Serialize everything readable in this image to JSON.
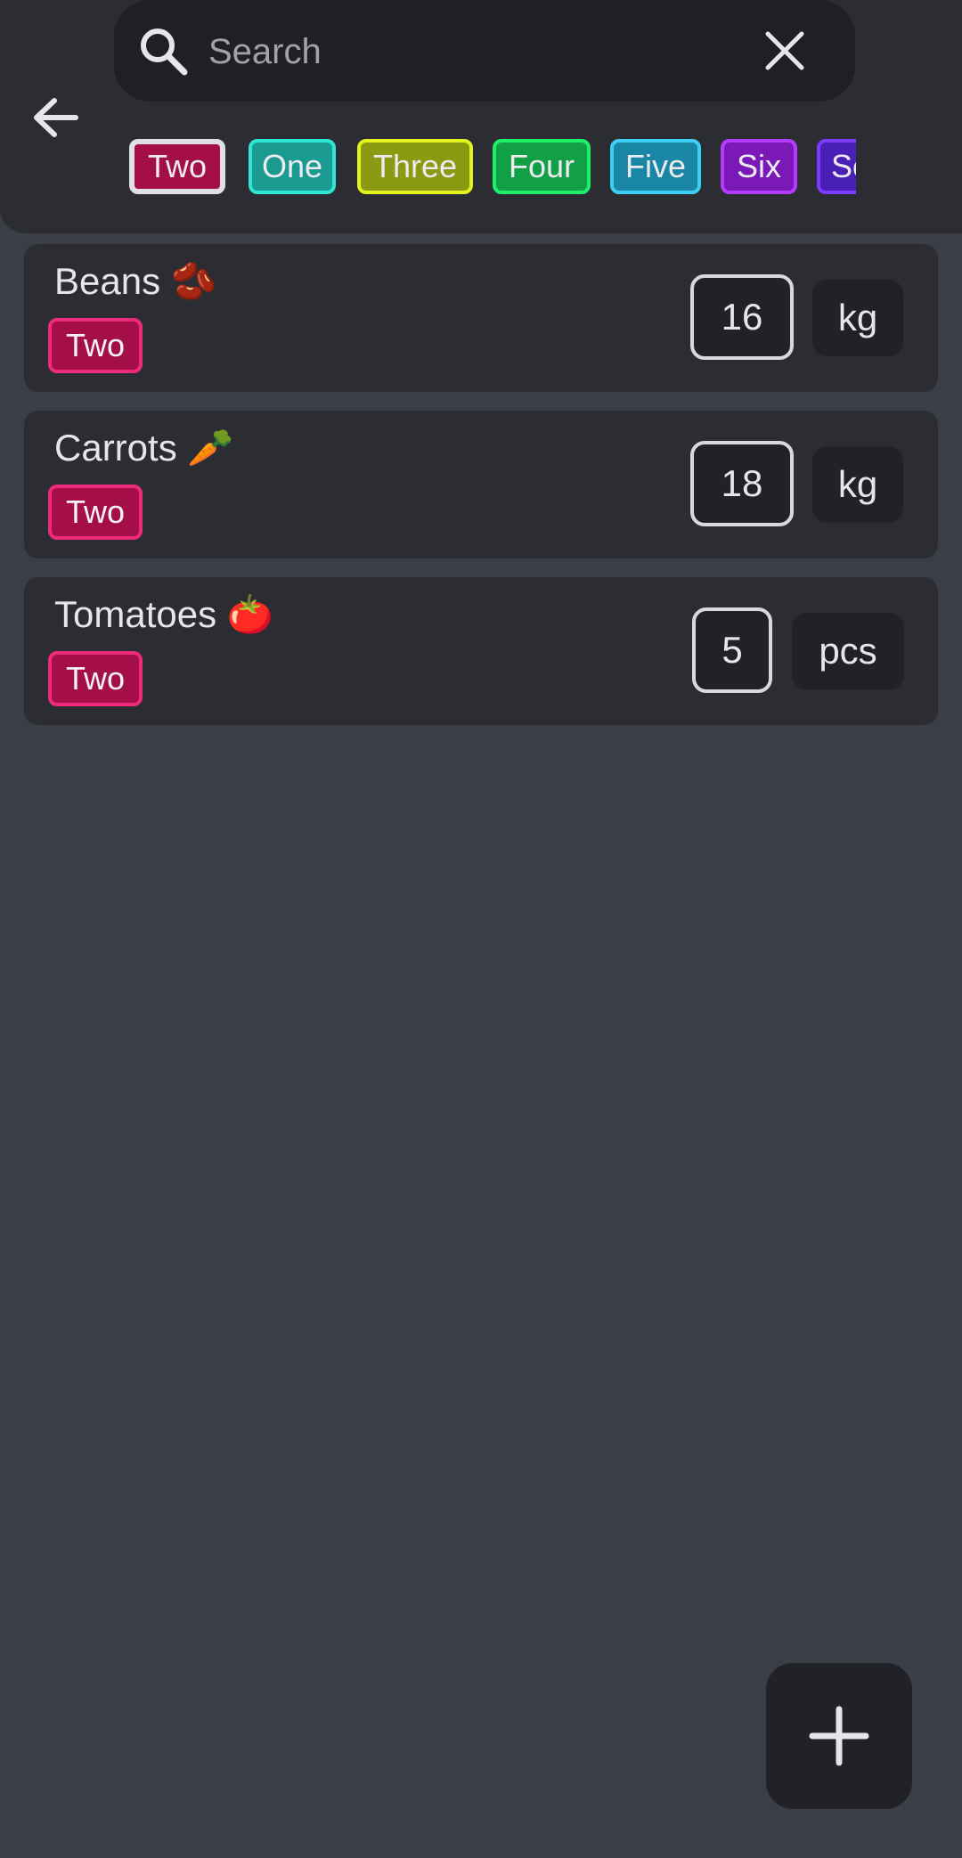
{
  "search": {
    "placeholder": "Search",
    "value": ""
  },
  "icons": {
    "back": "arrow-left-icon",
    "search": "search-icon",
    "clear": "close-icon",
    "add": "plus-icon"
  },
  "filter_chips": [
    {
      "label": "Two",
      "color": "#a50f48",
      "border": "#e0e0e4",
      "selected": true
    },
    {
      "label": "One",
      "color": "#1b9a92",
      "border": "#2ee6d4",
      "selected": false
    },
    {
      "label": "Three",
      "color": "#8a9a12",
      "border": "#e2f31d",
      "selected": false
    },
    {
      "label": "Four",
      "color": "#12a046",
      "border": "#1ff06a",
      "selected": false
    },
    {
      "label": "Five",
      "color": "#1a86a6",
      "border": "#3cd0f7",
      "selected": false
    },
    {
      "label": "Six",
      "color": "#7a18b8",
      "border": "#b33cff",
      "selected": false
    },
    {
      "label": "Se",
      "color": "#4a1fb8",
      "border": "#7a3cff",
      "selected": false
    }
  ],
  "items": [
    {
      "name": "Beans 🫘",
      "tag": "Two",
      "quantity": "16",
      "unit": "kg"
    },
    {
      "name": "Carrots 🥕",
      "tag": "Two",
      "quantity": "18",
      "unit": "kg"
    },
    {
      "name": "Tomatoes 🍅",
      "tag": "Two",
      "quantity": "5",
      "unit": "pcs"
    }
  ],
  "colors": {
    "background": "#3b3e47",
    "surface": "#2c2d32",
    "surface_dark": "#212227",
    "tag_fill": "#a50f48",
    "tag_border": "#ee2a7b"
  }
}
